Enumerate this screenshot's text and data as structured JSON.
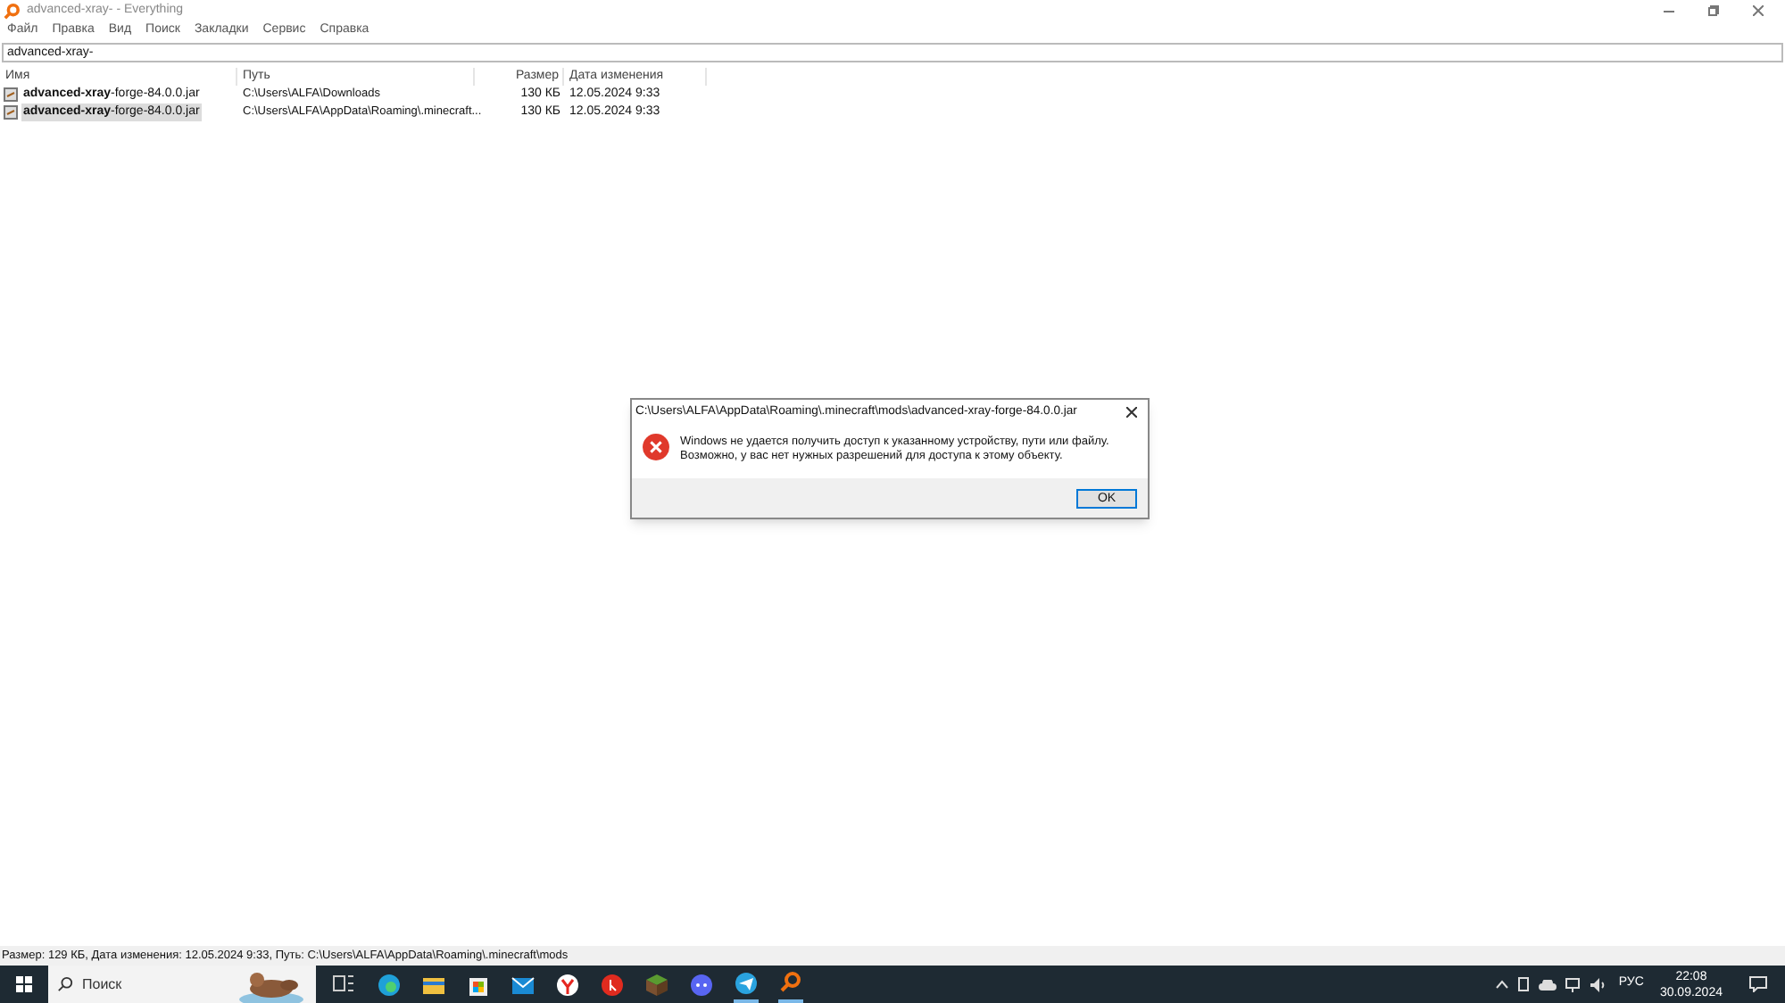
{
  "window": {
    "title": "advanced-xray- - Everything"
  },
  "menu": [
    "Файл",
    "Правка",
    "Вид",
    "Поиск",
    "Закладки",
    "Сервис",
    "Справка"
  ],
  "search": {
    "value": "advanced-xray-"
  },
  "table": {
    "columns": [
      "Имя",
      "Путь",
      "Размер",
      "Дата изменения"
    ],
    "rows": [
      {
        "name": "**advanced-xray**-forge-84.0.0.jar",
        "path": "C:\\Users\\ALFA\\Downloads",
        "size": "130 КБ",
        "date": "12.05.2024 9:33",
        "selected": false
      },
      {
        "name": "**advanced-xray**-forge-84.0.0.jar",
        "path": "C:\\Users\\ALFA\\AppData\\Roaming\\.minecraft...",
        "size": "130 КБ",
        "date": "12.05.2024 9:33",
        "selected": true
      }
    ]
  },
  "dialog": {
    "title": "C:\\Users\\ALFA\\AppData\\Roaming\\.minecraft\\mods\\advanced-xray-forge-84.0.0.jar",
    "message": [
      "Windows не удается получить доступ к указанному устройству, пути или файлу.",
      "Возможно, у вас нет нужных разрешений для доступа к этому объекту."
    ],
    "button": "OK"
  },
  "status_bar": "Размер: 129 КБ, Дата изменения: 12.05.2024 9:33, Путь: C:\\Users\\ALFA\\AppData\\Roaming\\.minecraft\\mods",
  "taskbar": {
    "search_placeholder": "Поиск",
    "language": "РУС",
    "time": "22:08",
    "date": "30.09.2024"
  }
}
